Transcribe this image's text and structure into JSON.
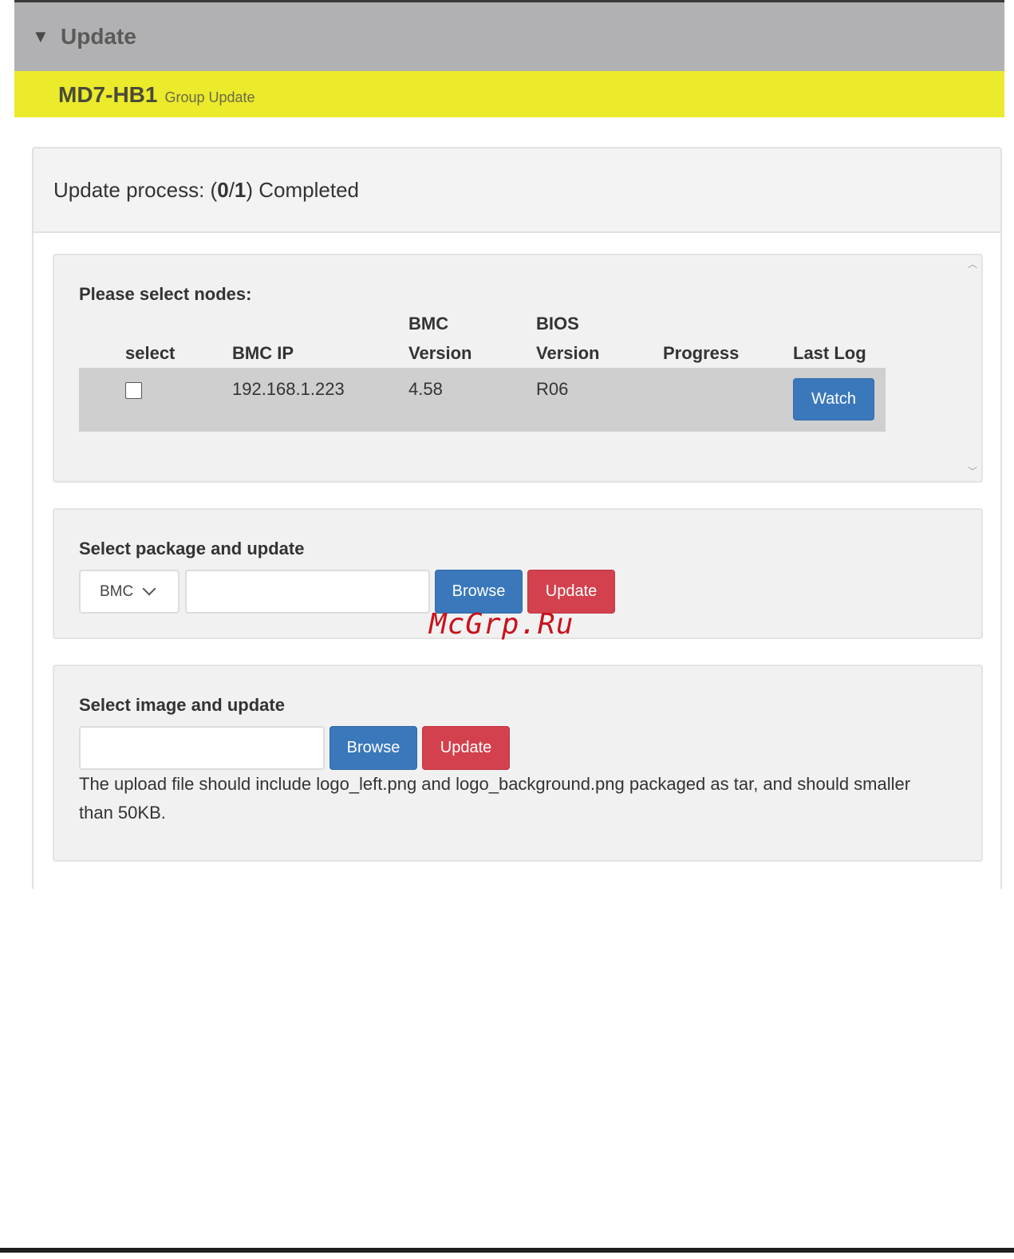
{
  "header": {
    "title": "Update"
  },
  "group": {
    "name": "MD7-HB1",
    "subtitle": "Group Update"
  },
  "status": {
    "label": "Update process: (",
    "done": "0",
    "sep": " / ",
    "total": "1",
    "suffix": ") Completed"
  },
  "nodes": {
    "title": "Please select nodes:",
    "columns": [
      "select",
      "BMC IP",
      "BMC",
      "Version",
      "BIOS",
      "Version",
      "Progress",
      "Last Log"
    ],
    "rows": [
      {
        "selected": false,
        "bmc_ip": "192.168.1.223",
        "bmc_version": "4.58",
        "bios_version": "R06",
        "progress": "",
        "last_log_button": "Watch"
      }
    ]
  },
  "package": {
    "title": "Select package and update",
    "type_selected": "BMC",
    "file_value": "",
    "browse_label": "Browse",
    "update_label": "Update"
  },
  "image": {
    "title": "Select image and update",
    "file_value": "",
    "browse_label": "Browse",
    "update_label": "Update",
    "help": "The upload file should include logo_left.png and logo_background.png packaged as tar, and should smaller than 50KB."
  },
  "watermark": "McGrp.Ru",
  "colors": {
    "header_bg": "#b1b1b3",
    "group_bg": "#ebea2b",
    "primary": "#3a78bb",
    "danger": "#d2414d"
  }
}
